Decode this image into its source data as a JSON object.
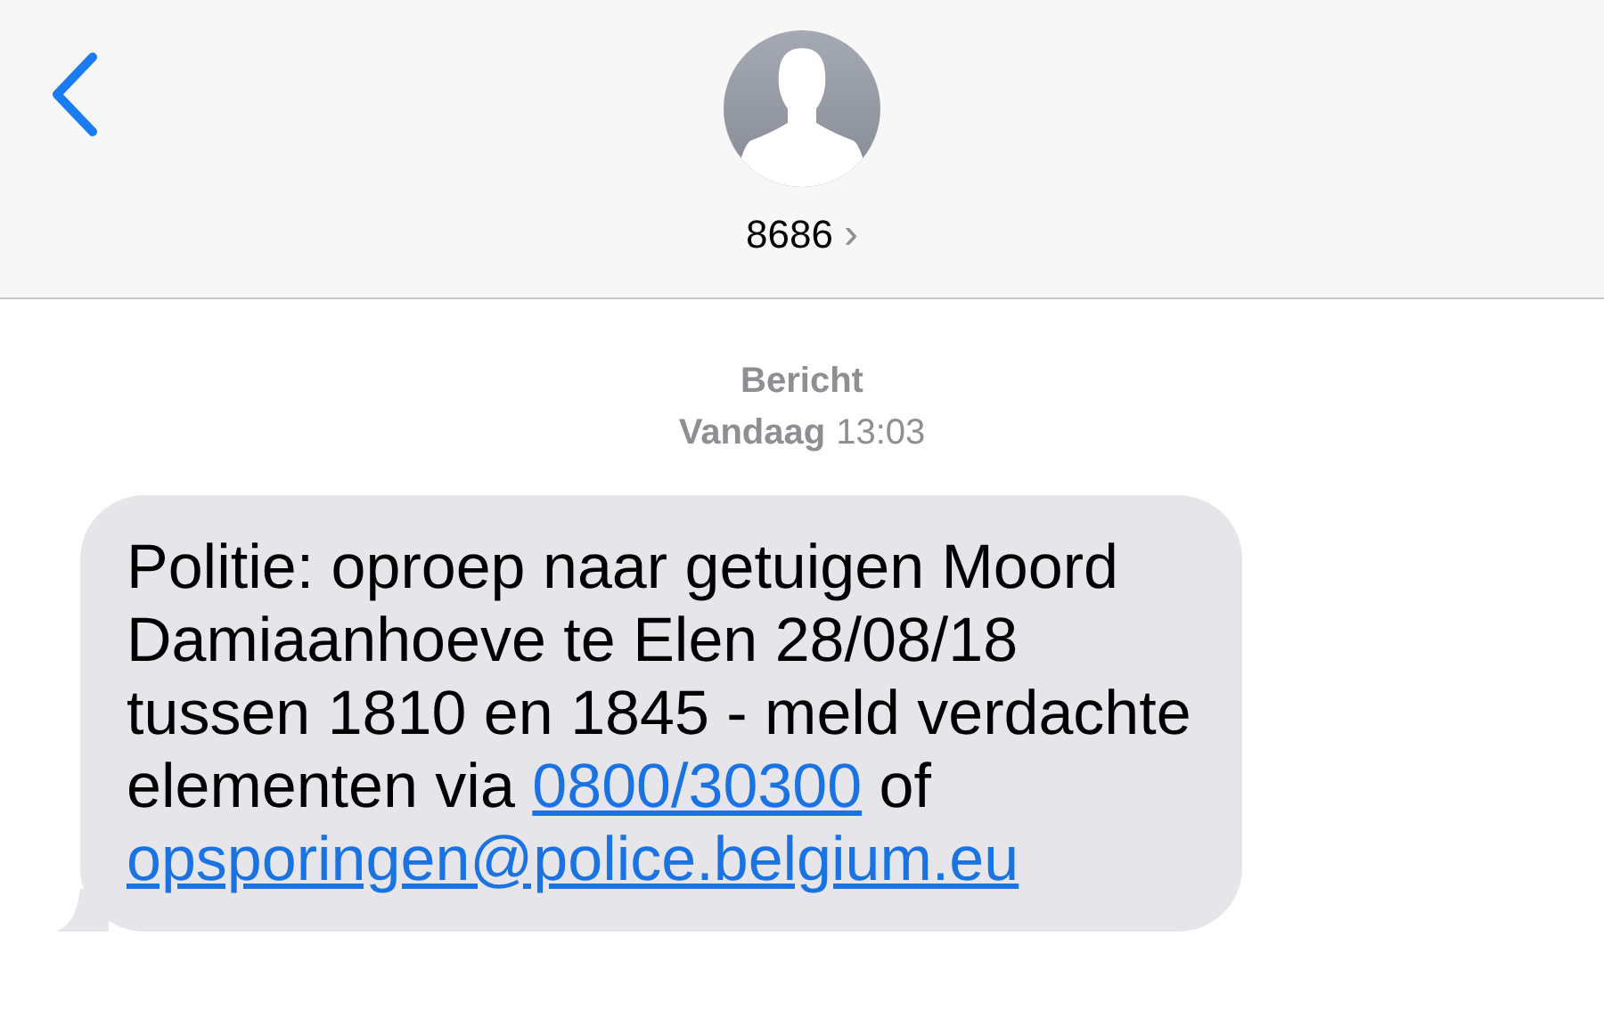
{
  "header": {
    "contact": "8686",
    "chevron": "›"
  },
  "timestamp": {
    "label": "Bericht",
    "day": "Vandaag",
    "time": "13:03"
  },
  "messages": [
    {
      "parts": [
        {
          "kind": "text",
          "text": "Politie: oproep naar getuigen Moord Damiaanhoeve te Elen 28/08/18 tussen 1810 en 1845 - meld verdachte elementen via "
        },
        {
          "kind": "link",
          "text": "0800/30300"
        },
        {
          "kind": "text",
          "text": " of "
        },
        {
          "kind": "link",
          "text": "opsporingen@police.belgium.eu"
        }
      ]
    }
  ]
}
